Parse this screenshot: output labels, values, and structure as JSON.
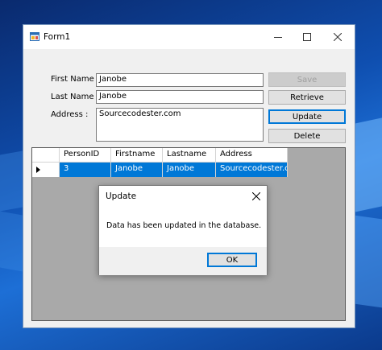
{
  "window": {
    "title": "Form1",
    "icon": "form-window-icon"
  },
  "form": {
    "firstname_label": "First Name :",
    "firstname_value": "Janobe",
    "lastname_label": "Last Name :",
    "lastname_value": "Janobe",
    "address_label": "Address :",
    "address_value": "Sourcecodester.com"
  },
  "buttons": {
    "save": "Save",
    "retrieve": "Retrieve",
    "update": "Update",
    "delete": "Delete"
  },
  "grid": {
    "columns": [
      "PersonID",
      "Firstname",
      "Lastname",
      "Address"
    ],
    "rows": [
      [
        "3",
        "Janobe",
        "Janobe",
        "Sourcecodester.com"
      ]
    ],
    "selection_color": "#0078d7"
  },
  "dialog": {
    "title": "Update",
    "message": "Data has been updated in the database.",
    "ok": "OK"
  },
  "colors": {
    "accent": "#0078d7",
    "window_bg": "#f0f0f0",
    "grid_bg": "#a9a9a9"
  }
}
